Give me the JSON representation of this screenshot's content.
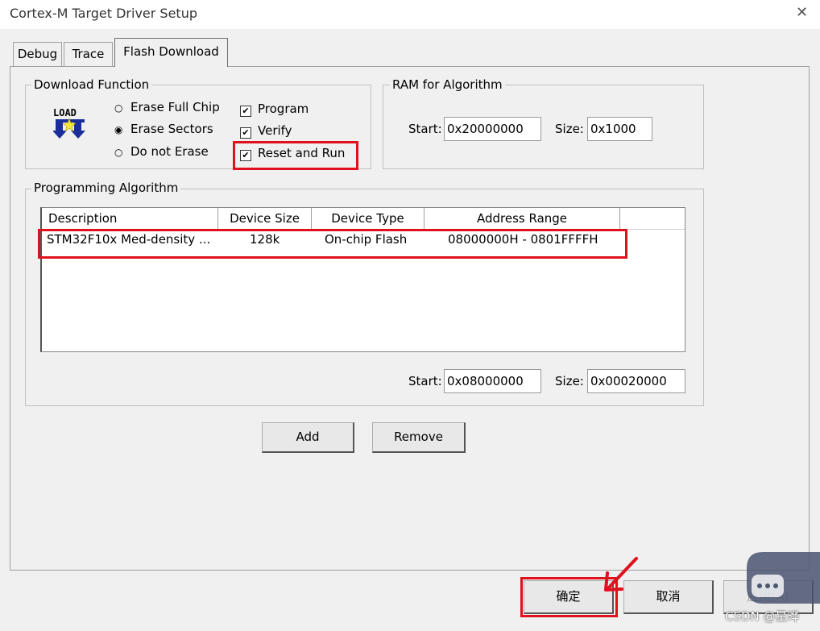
{
  "window": {
    "title": "Cortex-M Target Driver Setup",
    "close_glyph": "✕"
  },
  "tabs": [
    {
      "label": "Debug"
    },
    {
      "label": "Trace"
    },
    {
      "label": "Flash Download",
      "active": true
    }
  ],
  "download_function": {
    "legend": "Download Function",
    "icon_text": "LOAD",
    "radios": [
      {
        "label": "Erase Full Chip",
        "checked": false
      },
      {
        "label": "Erase Sectors",
        "checked": true
      },
      {
        "label": "Do not Erase",
        "checked": false
      }
    ],
    "checks": [
      {
        "label": "Program",
        "checked": true
      },
      {
        "label": "Verify",
        "checked": true
      },
      {
        "label": "Reset and Run",
        "checked": true
      }
    ]
  },
  "ram": {
    "legend": "RAM for Algorithm",
    "start_label": "Start:",
    "start_value": "0x20000000",
    "size_label": "Size:",
    "size_value": "0x1000"
  },
  "algorithm": {
    "legend": "Programming Algorithm",
    "columns": [
      "Description",
      "Device Size",
      "Device Type",
      "Address Range"
    ],
    "rows": [
      {
        "description": "STM32F10x Med-density ...",
        "device_size": "128k",
        "device_type": "On-chip Flash",
        "address_range": "08000000H - 0801FFFFH"
      }
    ],
    "start_label": "Start:",
    "start_value": "0x08000000",
    "size_label": "Size:",
    "size_value": "0x00020000",
    "add_label": "Add",
    "remove_label": "Remove"
  },
  "footer": {
    "ok_label": "确定",
    "cancel_label": "取消",
    "apply_label": "应用(A)",
    "watermark": "CSDN @星晔"
  },
  "colors": {
    "highlight": "#e0101c",
    "arrow": "#e0101c"
  }
}
